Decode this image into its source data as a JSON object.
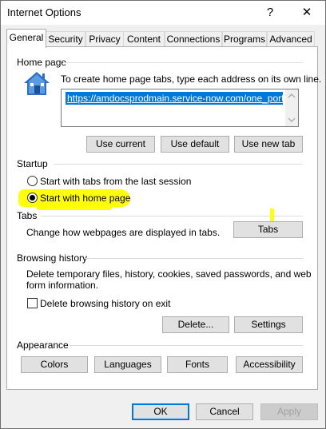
{
  "window": {
    "title": "Internet Options",
    "help_glyph": "?",
    "close_glyph": "✕"
  },
  "tabs": [
    {
      "label": "General",
      "active": true
    },
    {
      "label": "Security"
    },
    {
      "label": "Privacy"
    },
    {
      "label": "Content"
    },
    {
      "label": "Connections"
    },
    {
      "label": "Programs"
    },
    {
      "label": "Advanced"
    }
  ],
  "home_page": {
    "section_title": "Home page",
    "instructions": "To create home page tabs, type each address on its own line.",
    "url_value": "https://amdocsprodmain.service-now.com/one_portal",
    "use_current": "Use current",
    "use_default": "Use default",
    "use_new_tab": "Use new tab"
  },
  "startup": {
    "section_title": "Startup",
    "option_last_session": "Start with tabs from the last session",
    "option_home_page": "Start with home page",
    "selected": "option_home_page"
  },
  "tabs_section": {
    "section_title": "Tabs",
    "description": "Change how webpages are displayed in tabs.",
    "button": "Tabs"
  },
  "browsing_history": {
    "section_title": "Browsing history",
    "description_line1": "Delete temporary files, history, cookies, saved passwords, and web",
    "description_line2": "form information.",
    "delete_on_exit_label": "Delete browsing history on exit",
    "delete_on_exit_checked": false,
    "delete_button": "Delete...",
    "settings_button": "Settings"
  },
  "appearance": {
    "section_title": "Appearance",
    "colors": "Colors",
    "languages": "Languages",
    "fonts": "Fonts",
    "accessibility": "Accessibility"
  },
  "footer": {
    "ok": "OK",
    "cancel": "Cancel",
    "apply": "Apply"
  },
  "colors": {
    "accent": "#0078d7",
    "annotation_highlight": "#ffff00"
  },
  "icons": {
    "home": "house-icon"
  }
}
